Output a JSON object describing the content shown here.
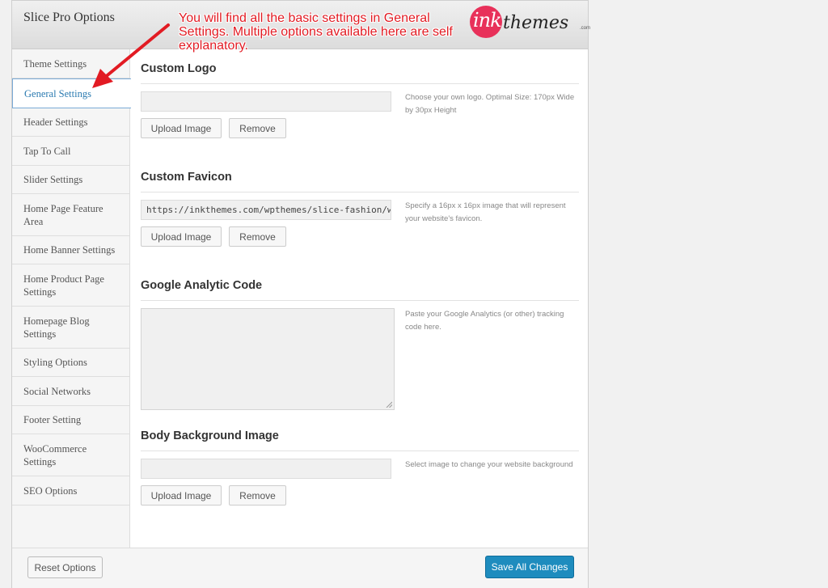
{
  "header": {
    "title": "Slice Pro Options",
    "annotation": "You will find all the basic settings in General Settings. Multiple options available here are self explanatory.",
    "logo_ink": "ink",
    "logo_themes": "themes",
    "logo_com": ".com"
  },
  "sidebar": {
    "items": [
      {
        "label": "Theme Settings"
      },
      {
        "label": "General Settings",
        "active": true
      },
      {
        "label": "Header Settings"
      },
      {
        "label": "Tap To Call"
      },
      {
        "label": "Slider Settings"
      },
      {
        "label": "Home Page Feature Area"
      },
      {
        "label": "Home Banner Settings"
      },
      {
        "label": "Home Product Page Settings"
      },
      {
        "label": "Homepage Blog Settings"
      },
      {
        "label": "Styling Options"
      },
      {
        "label": "Social Networks"
      },
      {
        "label": "Footer Setting"
      },
      {
        "label": "WooCommerce Settings"
      },
      {
        "label": "SEO Options"
      }
    ]
  },
  "sections": {
    "logo": {
      "title": "Custom Logo",
      "value": "",
      "description": "Choose your own logo. Optimal Size: 170px Wide by 30px Height",
      "upload_label": "Upload Image",
      "remove_label": "Remove"
    },
    "favicon": {
      "title": "Custom Favicon",
      "value": "https://inkthemes.com/wpthemes/slice-fashion/wp-cor",
      "description": "Specify a 16px x 16px image that will represent your website's favicon.",
      "upload_label": "Upload Image",
      "remove_label": "Remove"
    },
    "analytics": {
      "title": "Google Analytic Code",
      "value": "",
      "description": "Paste your Google Analytics (or other) tracking code here."
    },
    "background": {
      "title": "Body Background Image",
      "value": "",
      "description": "Select image to change your website background",
      "upload_label": "Upload Image",
      "remove_label": "Remove"
    }
  },
  "footer": {
    "reset_label": "Reset Options",
    "save_label": "Save All Changes"
  },
  "colors": {
    "accent": "#1e8cbe",
    "annotation": "#e21b23",
    "active_nav": "#2a7ab0",
    "logo_brand": "#e8315a"
  }
}
